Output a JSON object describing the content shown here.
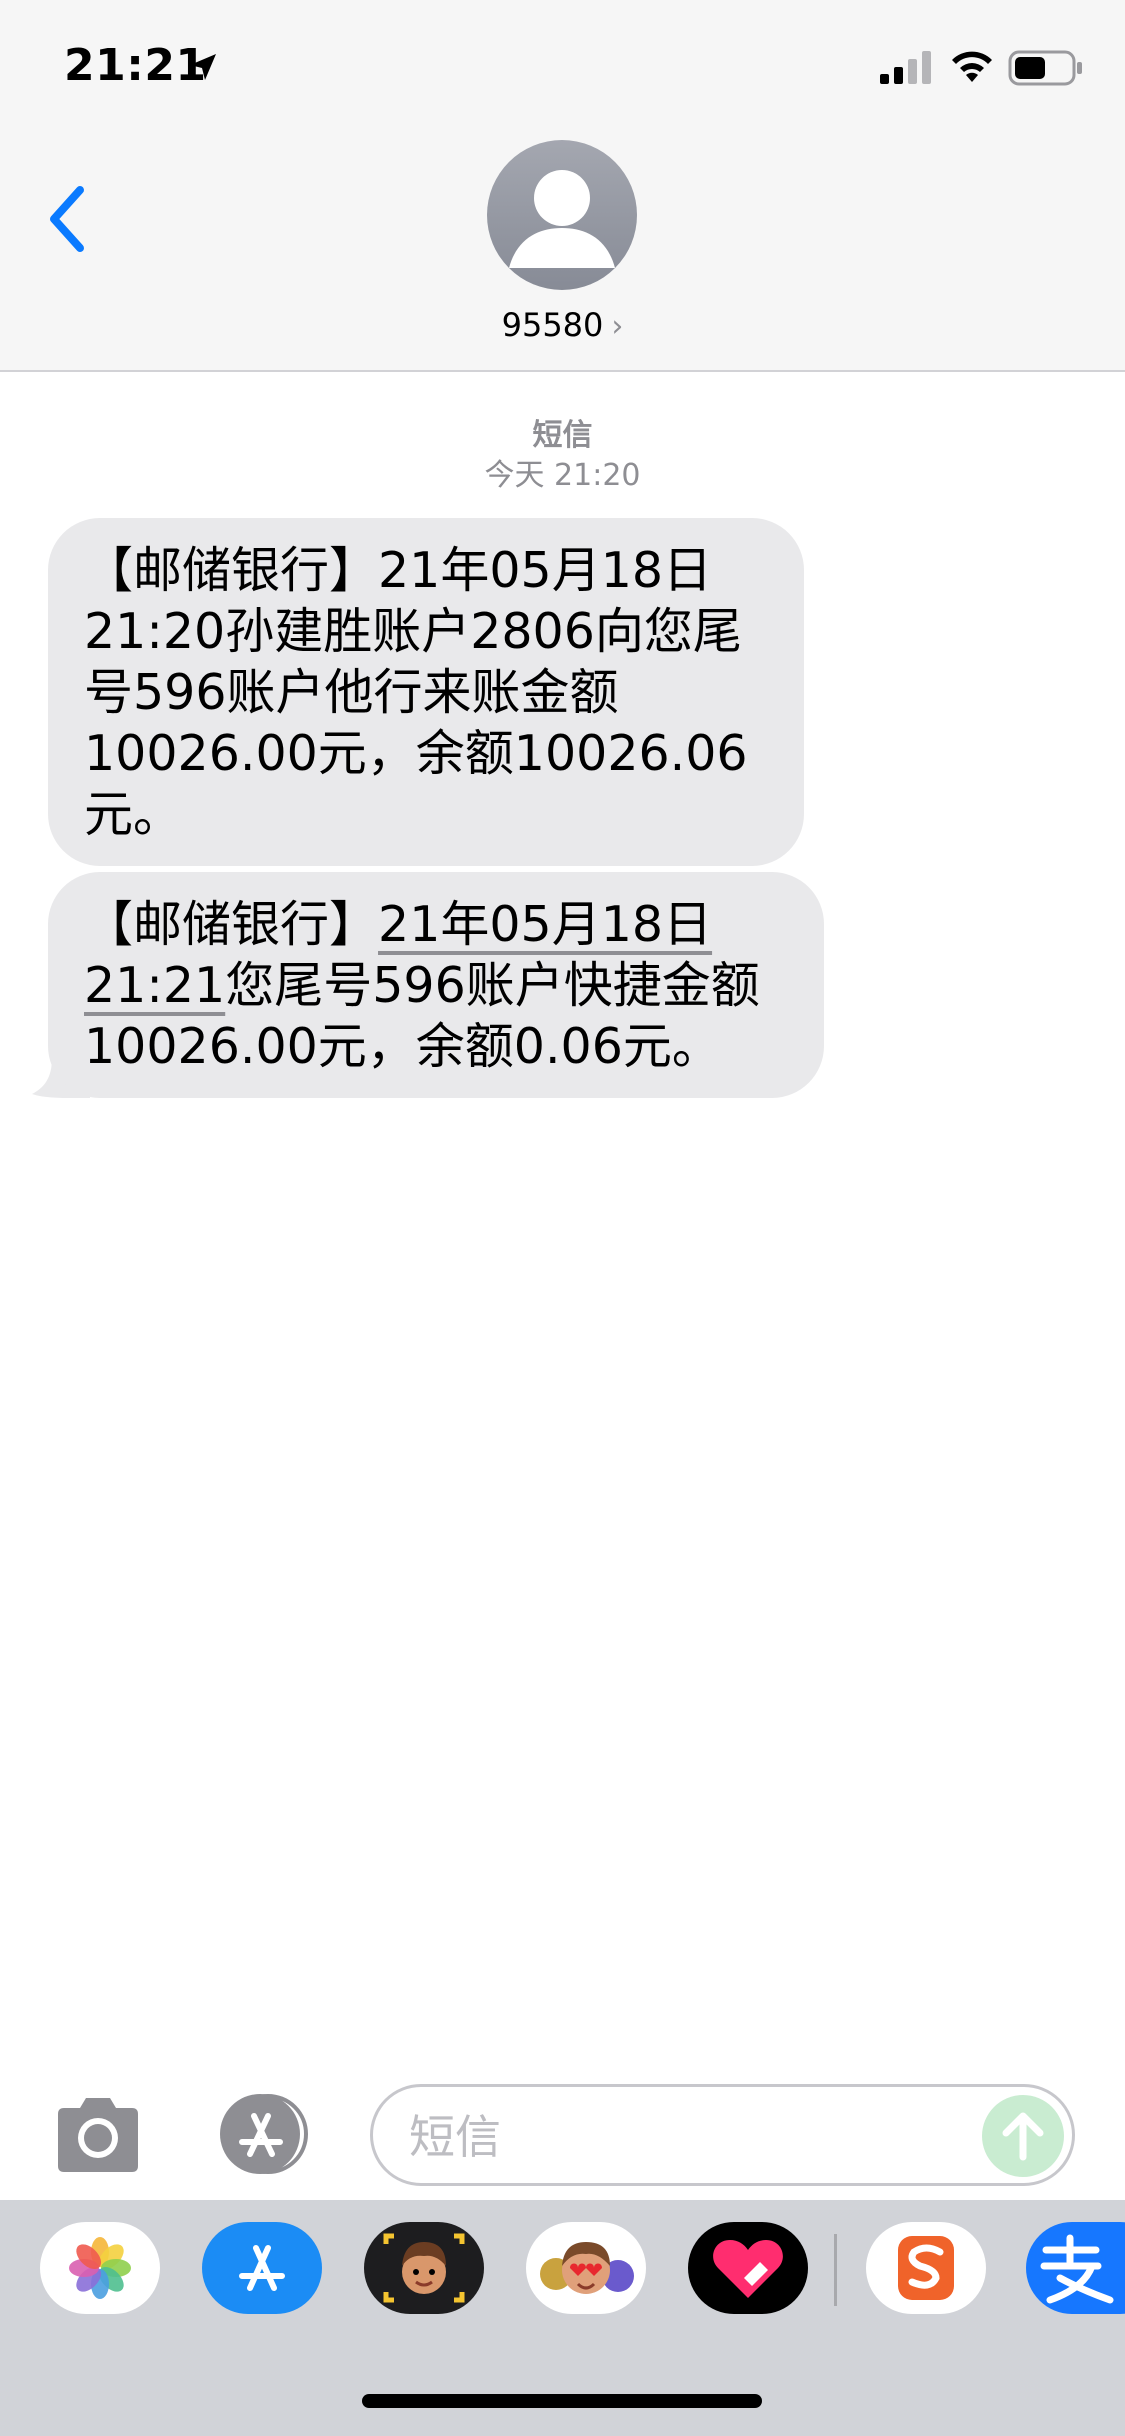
{
  "status_bar": {
    "time": "21:21"
  },
  "header": {
    "contact": "95580",
    "chevron": "›"
  },
  "conversation": {
    "service_label": "短信",
    "date_label": "今天 21:20",
    "messages": [
      {
        "text": "【邮储银行】21年05月18日\n21:20孙建胜账户2806向您尾\n号596账户他行来账金额\n10026.00元，余额10026.06\n元。"
      },
      {
        "prefix": "【邮储银行】",
        "date_link_1": "21年05月18日",
        "date_link_2": "21:21",
        "text_after_link": "您尾号596账户快捷金额\n10026.00元，余额0.06元。"
      }
    ]
  },
  "input": {
    "placeholder": "短信"
  },
  "colors": {
    "accent_blue": "#0a7aff",
    "bubble_gray": "#e9e9eb",
    "send_green": "#c9ecd1"
  },
  "icons": [
    "location-arrow-icon",
    "signal-icon",
    "wifi-icon",
    "battery-icon",
    "back-chevron-icon",
    "contact-avatar-icon",
    "camera-icon",
    "app-store-icon",
    "send-arrow-icon",
    "photos-app-icon",
    "memoji-icon",
    "animoji-icon",
    "digital-touch-icon",
    "sogou-icon",
    "alipay-icon"
  ]
}
